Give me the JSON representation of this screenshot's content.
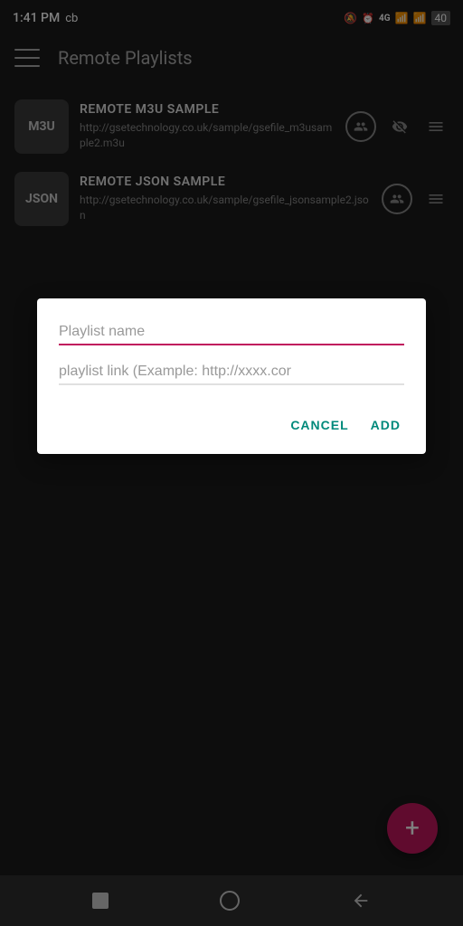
{
  "statusBar": {
    "time": "1:41 PM",
    "carrier": "cb",
    "icons": [
      "alarm",
      "clock",
      "lte",
      "signal",
      "wifi",
      "battery"
    ]
  },
  "appBar": {
    "title": "Remote Playlists",
    "menuIcon": "menu-icon"
  },
  "playlists": [
    {
      "id": 1,
      "type": "M3U",
      "name": "REMOTE M3U SAMPLE",
      "url": "http://gsetechnology.co.uk/sample/gsefile_m3usample2.m3u",
      "actions": [
        "people",
        "eye-slash",
        "menu"
      ]
    },
    {
      "id": 2,
      "type": "JSON",
      "name": "REMOTE JSON SAMPLE",
      "url": "http://gsetechnology.co.uk/sample/gsefile_jsonsample2.json",
      "actions": [
        "people",
        "menu"
      ]
    }
  ],
  "dialog": {
    "nameField": {
      "placeholder": "Playlist name",
      "value": ""
    },
    "urlField": {
      "placeholder": "playlist link (Example: http://xxxx.cor",
      "value": ""
    },
    "cancelLabel": "CANCEL",
    "addLabel": "ADD"
  },
  "fab": {
    "icon": "+",
    "ariaLabel": "Add playlist"
  },
  "navBar": {
    "items": [
      "stop",
      "home",
      "back"
    ]
  }
}
